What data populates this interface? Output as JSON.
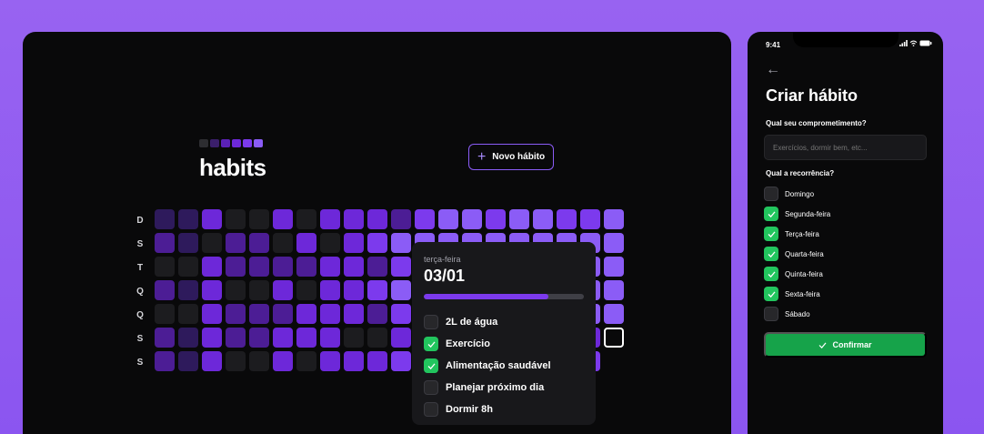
{
  "app": {
    "brand": "habits",
    "logo_colors": [
      "#2d2d31",
      "#3b1f6b",
      "#5b21b6",
      "#6d28d9",
      "#7c3aed",
      "#8b5cf6"
    ],
    "new_habit_label": "Novo hábito",
    "new_habit_icon": "plus-icon"
  },
  "summary_table": {
    "day_labels": [
      "D",
      "S",
      "T",
      "Q",
      "Q",
      "S",
      "S"
    ],
    "palette": [
      "#1c1c1f",
      "#2e1a5c",
      "#4c1d95",
      "#6d28d9",
      "#7c3aed",
      "#8b5cf6"
    ],
    "levels": [
      [
        1,
        1,
        3,
        0,
        0,
        3,
        0,
        3,
        3,
        3,
        2,
        4,
        5,
        5,
        4,
        5,
        5,
        4,
        4,
        5
      ],
      [
        2,
        1,
        0,
        2,
        2,
        0,
        3,
        0,
        3,
        4,
        5,
        5,
        5,
        5,
        5,
        5,
        5,
        5,
        5,
        5
      ],
      [
        0,
        0,
        3,
        2,
        2,
        2,
        2,
        3,
        3,
        2,
        4,
        5,
        5,
        4,
        5,
        5,
        4,
        5,
        5,
        5
      ],
      [
        2,
        1,
        3,
        0,
        0,
        3,
        0,
        3,
        3,
        4,
        5,
        5,
        5,
        5,
        5,
        5,
        5,
        5,
        5,
        5
      ],
      [
        0,
        0,
        3,
        2,
        2,
        2,
        3,
        3,
        3,
        2,
        4,
        5,
        5,
        4,
        5,
        5,
        4,
        5,
        5,
        5
      ],
      [
        2,
        1,
        3,
        2,
        2,
        3,
        3,
        3,
        0,
        0,
        3,
        4,
        4,
        4,
        4,
        4,
        4,
        3,
        3,
        -1
      ],
      [
        2,
        1,
        3,
        0,
        0,
        3,
        0,
        3,
        3,
        3,
        4,
        4,
        4,
        4,
        4,
        4,
        4,
        4,
        4,
        null
      ]
    ]
  },
  "popover": {
    "weekday": "terça-feira",
    "date": "03/01",
    "progress": 0.78,
    "habits": [
      {
        "label": "2L de água",
        "checked": false
      },
      {
        "label": "Exercício",
        "checked": true
      },
      {
        "label": "Alimentação saudável",
        "checked": true
      },
      {
        "label": "Planejar próximo dia",
        "checked": false
      },
      {
        "label": "Dormir 8h",
        "checked": false
      }
    ]
  },
  "phone": {
    "status_time": "9:41",
    "status_icons": [
      "signal-icon",
      "wifi-icon",
      "battery-icon"
    ],
    "back_icon": "arrow-left-icon",
    "title": "Criar hábito",
    "commitment_label": "Qual seu comprometimento?",
    "commitment_placeholder": "Exercícios, dormir bem, etc...",
    "recurrence_label": "Qual a recorrência?",
    "weekdays": [
      {
        "label": "Domingo",
        "checked": false
      },
      {
        "label": "Segunda-feira",
        "checked": true
      },
      {
        "label": "Terça-feira",
        "checked": true
      },
      {
        "label": "Quarta-feira",
        "checked": true
      },
      {
        "label": "Quinta-feira",
        "checked": true
      },
      {
        "label": "Sexta-feira",
        "checked": true
      },
      {
        "label": "Sábado",
        "checked": false
      }
    ],
    "confirm_label": "Confirmar",
    "confirm_color": "#16a34a"
  },
  "colors": {
    "background": "#9863f1",
    "panel": "#09090a",
    "accent": "#8b5cf6",
    "success": "#22c55e"
  }
}
